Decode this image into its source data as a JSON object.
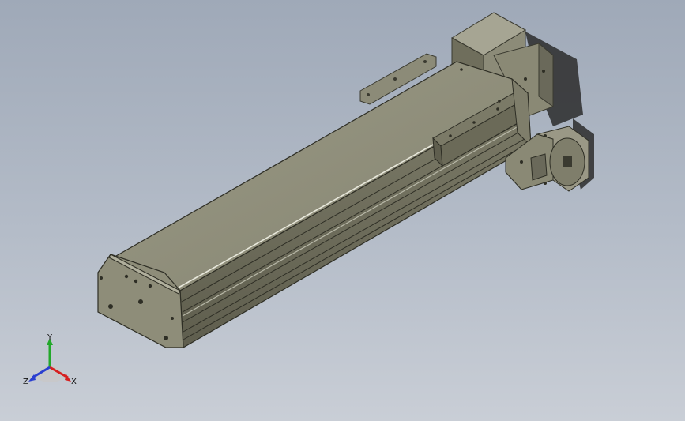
{
  "viewport": {
    "background_top": "#9fa9b8",
    "background_bottom": "#c9ced6"
  },
  "model": {
    "body_color": "#8e8d79",
    "body_dark": "#6f6e5c",
    "body_light": "#a6a593",
    "rail_color": "#7a7966",
    "motor_color": "#9a9886"
  },
  "triad": {
    "x_label": "X",
    "y_label": "Y",
    "z_label": "Z",
    "x_color": "#d62020",
    "y_color": "#22a82a",
    "z_color": "#2a3fd0"
  }
}
